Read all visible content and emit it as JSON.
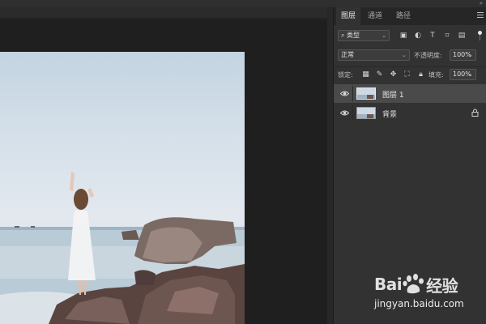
{
  "panel": {
    "tabs": [
      "图层",
      "通道",
      "路径"
    ],
    "filter": {
      "kind_label": "类型"
    },
    "blend": {
      "mode": "正常",
      "opacity_label": "不透明度:",
      "opacity_value": "100%"
    },
    "lock": {
      "label": "锁定:",
      "fill_label": "填充:",
      "fill_value": "100%"
    },
    "layers": [
      {
        "name": "图层 1",
        "visible": true,
        "selected": true,
        "locked": false
      },
      {
        "name": "背景",
        "visible": true,
        "selected": false,
        "locked": true
      }
    ]
  },
  "watermark": {
    "logo_text": "Bai",
    "logo_text_2": "经验",
    "url": "jingyan.baidu.com"
  },
  "colors": {
    "panel_bg": "#323232",
    "selected_layer": "#4a4a4a",
    "canvas_bg": "#1f1f1f"
  },
  "icons": {
    "filter_icons": [
      "image-filter-icon",
      "adjustment-filter-icon",
      "type-filter-icon",
      "shape-filter-icon",
      "smart-object-filter-icon"
    ],
    "lock_icons": [
      "lock-transparent-icon",
      "lock-paint-icon",
      "lock-move-icon",
      "lock-artboard-icon",
      "lock-all-icon"
    ]
  }
}
